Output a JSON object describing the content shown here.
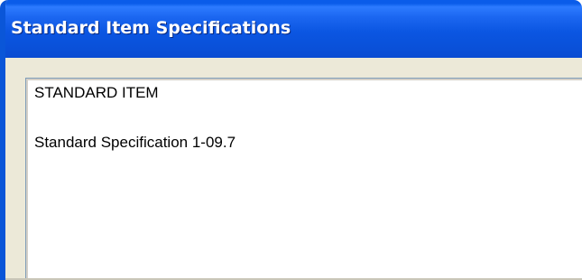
{
  "window": {
    "title": "Standard Item Specifications"
  },
  "content": {
    "lines": [
      "STANDARD ITEM",
      "Standard Specification 1-09.7"
    ]
  },
  "colors": {
    "titlebar": "#0a56d8",
    "client_background": "#ece9d8",
    "textbox_background": "#ffffff",
    "text": "#000000"
  }
}
